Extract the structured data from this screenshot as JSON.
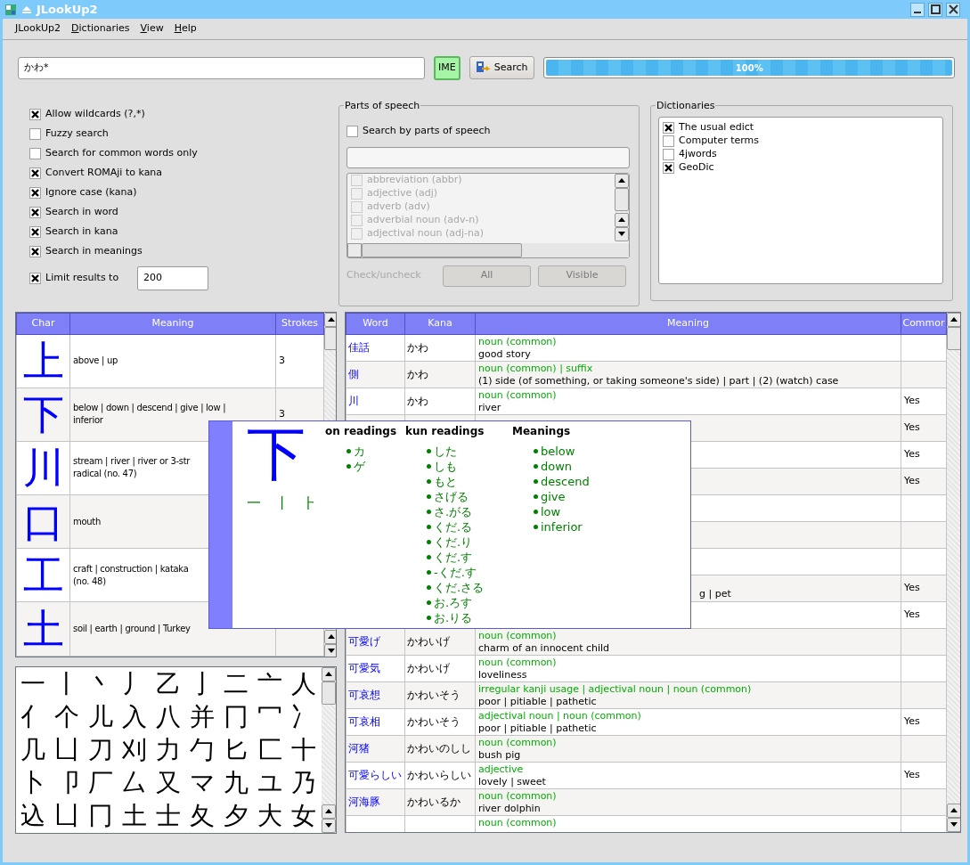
{
  "window": {
    "title": "JLookUp2"
  },
  "menu": [
    {
      "label": "JLookUp2"
    },
    {
      "label": "Dictionaries"
    },
    {
      "label": "View"
    },
    {
      "label": "Help"
    }
  ],
  "search": {
    "value": "かわ*",
    "ime_label": "IME",
    "button": "Search",
    "progress": {
      "level": 1,
      "reading": "100%"
    }
  },
  "options": [
    {
      "label": "Allow wildcards (?,*)",
      "checked": true
    },
    {
      "label": "Fuzzy search",
      "checked": false
    },
    {
      "label": "Search for common words only",
      "checked": false
    },
    {
      "label": "Convert ROMAji to kana",
      "checked": true
    },
    {
      "label": "Ignore case (kana)",
      "checked": true
    },
    {
      "label": "Search in word",
      "checked": true
    },
    {
      "label": "Search in kana",
      "checked": true
    },
    {
      "label": "Search in meanings",
      "checked": true
    }
  ],
  "limit": {
    "label": "Limit results to",
    "checked": true,
    "value": "200"
  },
  "parts_of_speech": {
    "title": "Parts of speech",
    "toggle": {
      "label": "Search by parts of speech",
      "checked": false
    },
    "items": [
      {
        "label": "abbreviation (abbr)",
        "checked": false
      },
      {
        "label": "adjective (adj)",
        "checked": false
      },
      {
        "label": "adverb (adv)",
        "checked": false
      },
      {
        "label": "adverbial noun (adv-n)",
        "checked": false
      },
      {
        "label": "adjectival noun (adj-na)",
        "checked": false
      }
    ],
    "disabled": true,
    "check_label": "Check/uncheck",
    "buttons": [
      "All",
      "Visible"
    ]
  },
  "dictionaries": {
    "title": "Dictionaries",
    "items": [
      {
        "label": "The usual edict",
        "checked": true
      },
      {
        "label": "Computer terms",
        "checked": false
      },
      {
        "label": "4jwords",
        "checked": false
      },
      {
        "label": "GeoDic",
        "checked": true
      }
    ]
  },
  "kanji_table": {
    "columns": [
      "Char",
      "Meaning",
      "Strokes"
    ],
    "rows": [
      {
        "char": "上",
        "meaning": "above | up",
        "strokes": "3"
      },
      {
        "char": "下",
        "meaning": "below | down | descend | give | low |\ninferior",
        "strokes": "3"
      },
      {
        "char": "川",
        "meaning": "stream | river | river or 3-str\nradical (no. 47)"
      },
      {
        "char": "口",
        "meaning": "mouth"
      },
      {
        "char": "工",
        "meaning": "craft | construction | kataka\n(no. 48)"
      },
      {
        "char": "土",
        "meaning": "soil | earth | ground | Turkey"
      }
    ]
  },
  "radicals": [
    "一",
    "丨",
    "丶",
    "丿",
    "乙",
    "亅",
    "二",
    "亠",
    "人",
    "亻",
    "个",
    "儿",
    "入",
    "八",
    "并",
    "冂",
    "冖",
    "冫",
    "几",
    "凵",
    "刀",
    "刈",
    "力",
    "勹",
    "匕",
    "匚",
    "十",
    "卜",
    "卩",
    "厂",
    "厶",
    "又",
    "マ",
    "九",
    "ユ",
    "乃",
    "込",
    "凵",
    "冂",
    "土",
    "士",
    "夂",
    "夕",
    "大",
    "女"
  ],
  "word_table": {
    "columns": [
      "Word",
      "Kana",
      "Meaning",
      "Commor"
    ],
    "rows": [
      {
        "word": "佳話",
        "kana": "かわ",
        "pos": "noun (common)",
        "meaning": "good story"
      },
      {
        "word": "側",
        "kana": "かわ",
        "pos": "noun (common) | suffix",
        "meaning": "(1) side (of something, or taking someone's side) | part | (2) (watch) case"
      },
      {
        "word": "川",
        "kana": "かわ",
        "pos": "noun (common)",
        "meaning": "river",
        "common": "Yes"
      },
      {
        "common": "Yes"
      },
      {
        "common": "Yes"
      },
      {
        "common": "Yes"
      },
      {},
      {},
      {},
      {
        "meaning_tail": "g | pet",
        "common": "Yes"
      },
      {
        "common": "Yes"
      },
      {
        "word": "可愛げ",
        "kana": "かわいげ",
        "pos": "noun (common)",
        "meaning": "charm of an innocent child"
      },
      {
        "word": "可愛気",
        "kana": "かわいげ",
        "pos": "noun (common)",
        "meaning": "loveliness"
      },
      {
        "word": "可哀想",
        "kana": "かわいそう",
        "pos": "irregular kanji usage | adjectival noun | noun (common)",
        "meaning": "poor | pitiable | pathetic"
      },
      {
        "word": "可哀相",
        "kana": "かわいそう",
        "pos": "adjectival noun | noun (common)",
        "meaning": "poor | pitiable | pathetic",
        "common": "Yes"
      },
      {
        "word": "河猪",
        "kana": "かわいのしし",
        "pos": "noun (common)",
        "meaning": "bush pig"
      },
      {
        "word": "可愛らしい",
        "kana": "かわいらしい",
        "pos": "adjective",
        "meaning": "lovely | sweet",
        "common": "Yes"
      },
      {
        "word": "河海豚",
        "kana": "かわいるか",
        "pos": "noun (common)",
        "meaning": "river dolphin"
      },
      {
        "pos": "noun (common)"
      }
    ]
  },
  "kanji_popup": {
    "char": "下",
    "parts": [
      "一",
      "丨",
      "⺊"
    ],
    "columns": [
      {
        "title": "on readings",
        "items": [
          "カ",
          "ゲ"
        ]
      },
      {
        "title": "kun readings",
        "items": [
          "した",
          "しも",
          "もと",
          "さげる",
          "さ.がる",
          "くだ.る",
          "くだ.り",
          "くだ.す",
          "-くだ.す",
          "くだ.さる",
          "お.ろす",
          "お.りる"
        ]
      },
      {
        "title": "Meanings",
        "items": [
          "below",
          "down",
          "descend",
          "give",
          "low",
          "inferior"
        ]
      }
    ]
  }
}
